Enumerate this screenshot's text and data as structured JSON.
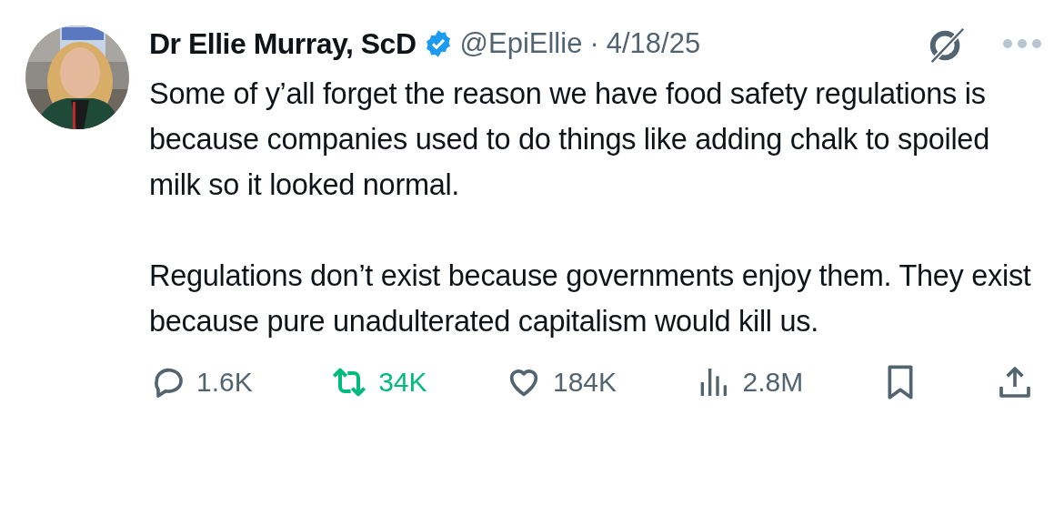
{
  "author": {
    "name": "Dr Ellie Murray, ScD",
    "verified": true,
    "handle": "@EpiEllie",
    "separator": "·",
    "date": "4/18/25"
  },
  "paragraphs": [
    "Some of y’all forget the reason we have food safety regulations is because companies used to do things like adding chalk to spoiled milk so it looked normal.",
    "Regulations don’t exist because governments enjoy them. They exist because pure unadulterated capitalism would kill us."
  ],
  "actions": [
    {
      "kind": "reply",
      "count": "1.6K",
      "active": false
    },
    {
      "kind": "repost",
      "count": "34K",
      "active": true
    },
    {
      "kind": "like",
      "count": "184K",
      "active": false
    },
    {
      "kind": "views",
      "count": "2.8M",
      "active": false
    },
    {
      "kind": "bookmark",
      "active": false
    },
    {
      "kind": "share",
      "active": false
    }
  ]
}
